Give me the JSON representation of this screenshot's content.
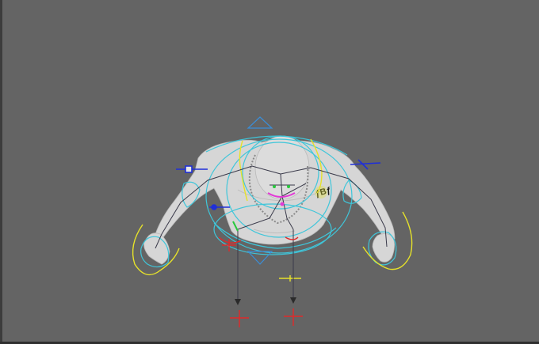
{
  "viewport": {
    "background_color": "#646464",
    "content": "3d-character-rig"
  },
  "rig": {
    "mesh_color": "#d9d9d9",
    "control_colors": {
      "cyan_curves": "#3fc6da",
      "yellow_curves": "#e6e22a",
      "blue_handles": "#1f2fd8",
      "red_locators": "#e02a2a",
      "skeleton_lines": "#3a3a4a",
      "green_joints": "#28c83c",
      "magenta_joints": "#e23ad6"
    },
    "tattoo_text": "ƒBƒ"
  }
}
